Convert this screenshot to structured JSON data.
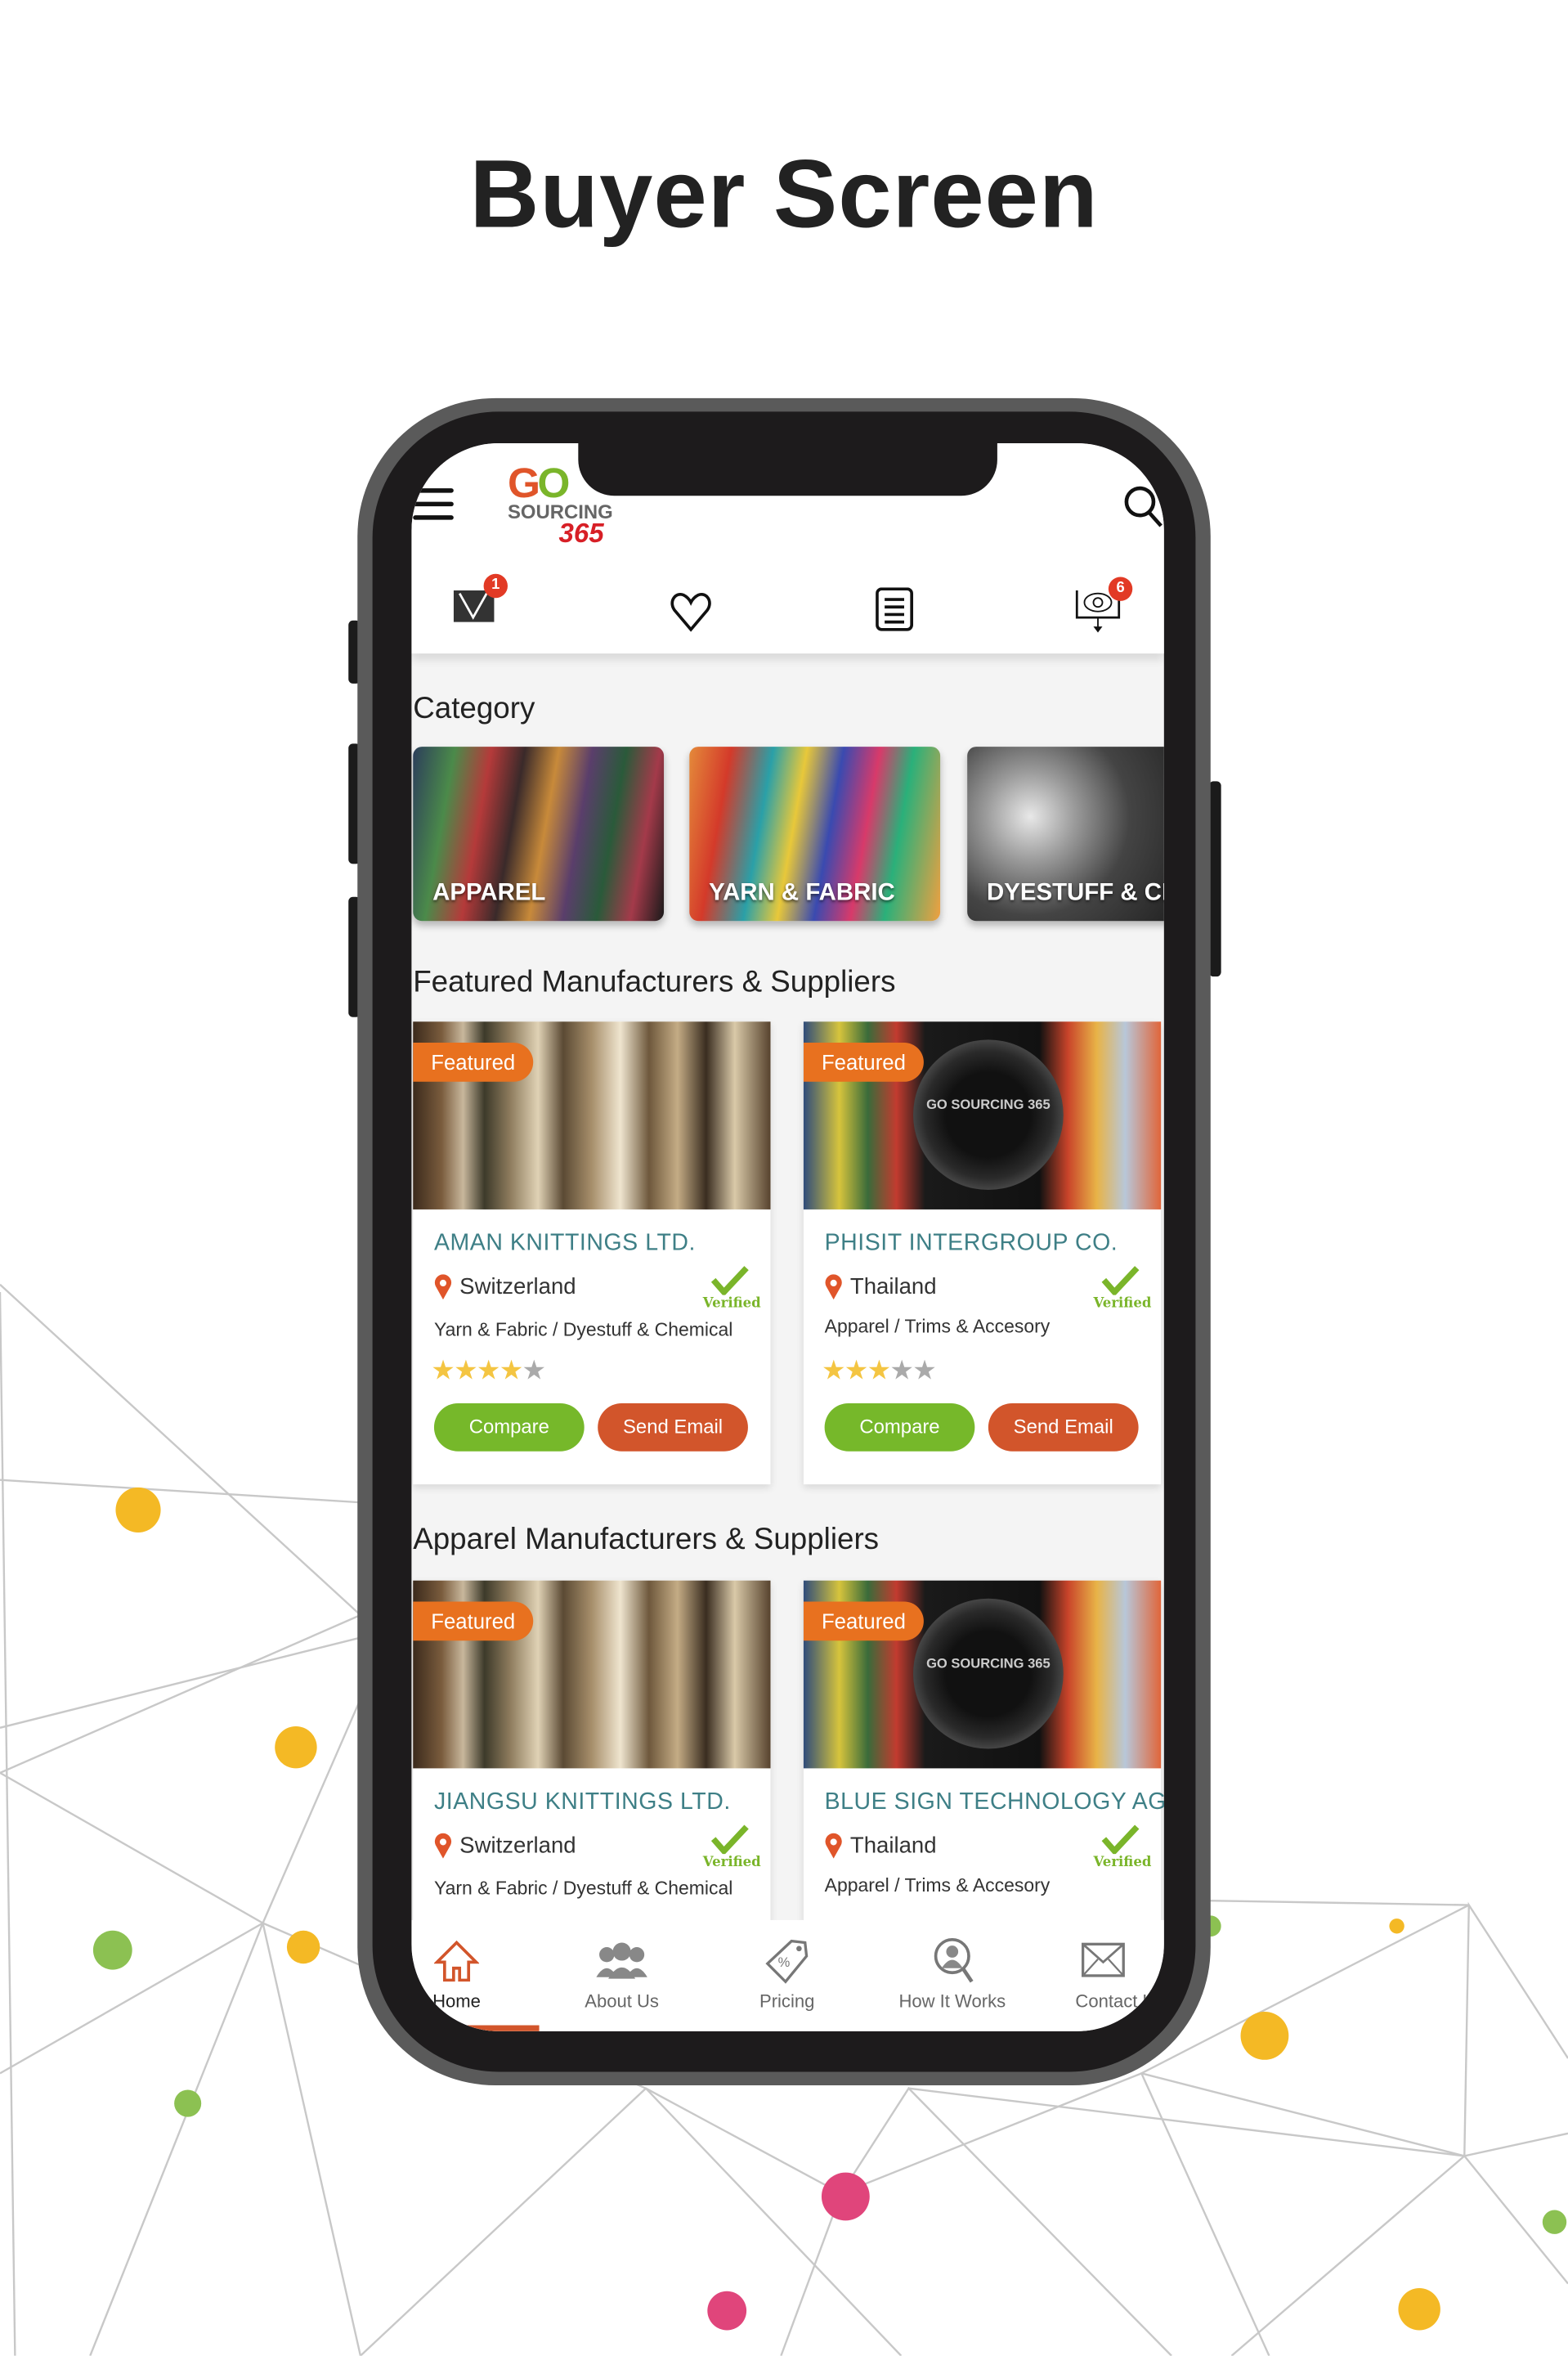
{
  "page_title": "Buyer Screen",
  "colors": {
    "accent_orange": "#e8711f",
    "green": "#76b82a",
    "email_red": "#d2552b",
    "teal": "#3e7f86",
    "badge_red": "#e23a25"
  },
  "logo": {
    "line1": "GO",
    "line2": "SOURCING",
    "line3": "365"
  },
  "header": {
    "icons": [
      "menu-icon",
      "search-icon",
      "mail-icon",
      "heart-icon",
      "list-icon",
      "eye-monitor-icon"
    ],
    "mail_badge": "1",
    "views_badge": "6"
  },
  "category": {
    "title": "Category",
    "items": [
      {
        "label": "APPAREL"
      },
      {
        "label": "YARN & FABRIC"
      },
      {
        "label": "DYESTUFF & CH"
      }
    ]
  },
  "featured": {
    "title": "Featured Manufacturers & Suppliers",
    "cards": [
      {
        "badge": "Featured",
        "name": "AMAN KNITTINGS LTD.",
        "location": "Switzerland",
        "verified": "Verified",
        "categories": "Yarn & Fabric / Dyestuff & Chemical",
        "rating": 4,
        "compare": "Compare",
        "email": "Send Email"
      },
      {
        "badge": "Featured",
        "name": "PHISIT INTERGROUP CO.",
        "location": "Thailand",
        "verified": "Verified",
        "categories": "Apparel / Trims & Accesory",
        "rating": 3,
        "compare": "Compare",
        "email": "Send Email",
        "image_text": "GO SOURCING 365"
      }
    ]
  },
  "apparel": {
    "title": "Apparel Manufacturers & Suppliers",
    "cards": [
      {
        "badge": "Featured",
        "name": "JIANGSU KNITTINGS LTD.",
        "location": "Switzerland",
        "verified": "Verified",
        "categories": "Yarn & Fabric / Dyestuff & Chemical"
      },
      {
        "badge": "Featured",
        "name": "BLUE SIGN TECHNOLOGY AG",
        "location": "Thailand",
        "verified": "Verified",
        "categories": "Apparel / Trims & Accesory",
        "image_text": "GO SOURCING 365"
      }
    ]
  },
  "bottom_nav": {
    "active": "Home",
    "items": [
      {
        "label": "Home",
        "icon": "home-icon"
      },
      {
        "label": "About Us",
        "icon": "people-icon"
      },
      {
        "label": "Pricing",
        "icon": "price-tag-icon"
      },
      {
        "label": "How It Works",
        "icon": "search-person-icon"
      },
      {
        "label": "Contact Us",
        "icon": "envelope-icon"
      }
    ]
  }
}
